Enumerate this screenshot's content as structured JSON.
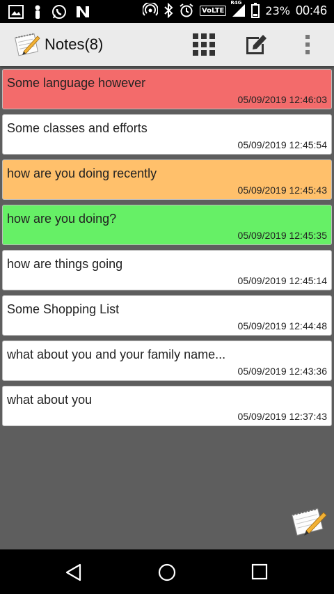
{
  "status_bar": {
    "battery_percent": "23%",
    "time": "00:46",
    "volte_label": "VoLTE",
    "signal_tag": "R4G"
  },
  "app_bar": {
    "title": "Notes(8)"
  },
  "notes": [
    {
      "title": "Some language however",
      "timestamp": "05/09/2019 12:46:03",
      "color": "#f36b6b"
    },
    {
      "title": "Some classes and efforts",
      "timestamp": "05/09/2019 12:45:54",
      "color": "#ffffff"
    },
    {
      "title": "how are you doing recently",
      "timestamp": "05/09/2019 12:45:43",
      "color": "#ffc06b"
    },
    {
      "title": "how are you doing?",
      "timestamp": "05/09/2019 12:45:35",
      "color": "#66f066"
    },
    {
      "title": "how are things going",
      "timestamp": "05/09/2019 12:45:14",
      "color": "#ffffff"
    },
    {
      "title": "Some Shopping List",
      "timestamp": "05/09/2019 12:44:48",
      "color": "#ffffff"
    },
    {
      "title": "what about you and your family name...",
      "timestamp": "05/09/2019 12:43:36",
      "color": "#ffffff"
    },
    {
      "title": "what about you",
      "timestamp": "05/09/2019 12:37:43",
      "color": "#ffffff"
    }
  ],
  "icons": {
    "grid": "grid-view-icon",
    "edit": "edit-note-icon",
    "more": "more-vert-icon",
    "fab": "notepad-pencil-icon"
  }
}
